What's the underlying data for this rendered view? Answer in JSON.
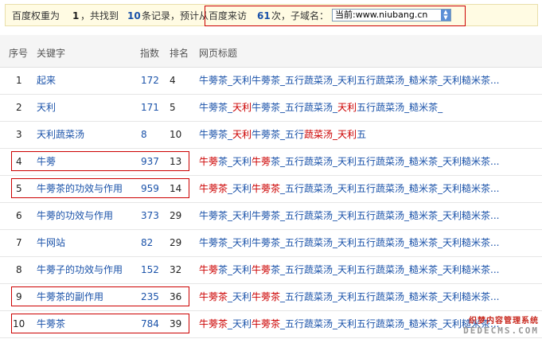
{
  "summary": {
    "prefix": "百度权重为",
    "weight": "1",
    "mid1": "，共找到",
    "count": "10",
    "mid2": "条记录，预计从百度来访",
    "visits": "61",
    "mid3": "次，子域名：",
    "subdomain_selected": "当前:www.niubang.cn"
  },
  "table": {
    "headers": {
      "seq": "序号",
      "keyword": "关键字",
      "index": "指数",
      "rank": "排名",
      "title": "网页标题"
    },
    "rows": [
      {
        "seq": "1",
        "keyword": "起来",
        "index": "172",
        "rank": "4",
        "title": [
          [
            "牛蒡茶_天利牛蒡茶_五行蔬菜汤_天利五行蔬菜汤_糙米茶_天利糙米茶...",
            false
          ]
        ]
      },
      {
        "seq": "2",
        "keyword": "天利",
        "index": "171",
        "rank": "5",
        "title": [
          [
            "牛蒡茶_",
            false
          ],
          [
            "天利",
            true
          ],
          [
            "牛蒡茶_五行蔬菜汤_",
            false
          ],
          [
            "天利",
            true
          ],
          [
            "五行蔬菜汤_糙米茶_",
            false
          ]
        ]
      },
      {
        "seq": "3",
        "keyword": "天利蔬菜汤",
        "index": "8",
        "rank": "10",
        "title": [
          [
            "牛蒡茶_",
            false
          ],
          [
            "天利",
            true
          ],
          [
            "牛蒡茶_五行",
            false
          ],
          [
            "蔬菜汤_天利",
            true
          ],
          [
            "五",
            false
          ]
        ]
      },
      {
        "seq": "4",
        "keyword": "牛蒡",
        "index": "937",
        "rank": "13",
        "title": [
          [
            "牛蒡",
            true
          ],
          [
            "茶_天利",
            false
          ],
          [
            "牛蒡",
            true
          ],
          [
            "茶_五行蔬菜汤_天利五行蔬菜汤_糙米茶_天利糙米茶...",
            false
          ]
        ]
      },
      {
        "seq": "5",
        "keyword": "牛蒡茶的功效与作用",
        "index": "959",
        "rank": "14",
        "title": [
          [
            "牛蒡茶",
            true
          ],
          [
            "_天利",
            false
          ],
          [
            "牛蒡茶",
            true
          ],
          [
            "_五行蔬菜汤_天利五行蔬菜汤_糙米茶_天利糙米茶...",
            false
          ]
        ]
      },
      {
        "seq": "6",
        "keyword": "牛蒡的功效与作用",
        "index": "373",
        "rank": "29",
        "title": [
          [
            "牛蒡茶_天利牛蒡茶_五行蔬菜汤_天利五行蔬菜汤_糙米茶_天利糙米茶...",
            false
          ]
        ]
      },
      {
        "seq": "7",
        "keyword": "牛网站",
        "index": "82",
        "rank": "29",
        "title": [
          [
            "牛蒡茶_天利牛蒡茶_五行蔬菜汤_天利五行蔬菜汤_糙米茶_天利糙米茶...",
            false
          ]
        ]
      },
      {
        "seq": "8",
        "keyword": "牛蒡子的功效与作用",
        "index": "152",
        "rank": "32",
        "title": [
          [
            "牛蒡",
            true
          ],
          [
            "茶_天利",
            false
          ],
          [
            "牛蒡",
            true
          ],
          [
            "茶_五行蔬菜汤_天利五行蔬菜汤_糙米茶_天利糙米茶...",
            false
          ]
        ]
      },
      {
        "seq": "9",
        "keyword": "牛蒡茶的副作用",
        "index": "235",
        "rank": "36",
        "title": [
          [
            "牛蒡茶",
            true
          ],
          [
            "_天利",
            false
          ],
          [
            "牛蒡茶",
            true
          ],
          [
            "_五行蔬菜汤_天利五行蔬菜汤_糙米茶_天利糙米茶...",
            false
          ]
        ]
      },
      {
        "seq": "10",
        "keyword": "牛蒡茶",
        "index": "784",
        "rank": "39",
        "title": [
          [
            "牛蒡茶",
            true
          ],
          [
            "_天利",
            false
          ],
          [
            "牛蒡茶",
            true
          ],
          [
            "_五行蔬菜汤_天利五行蔬菜汤_糙米茶_天利糙米茶...",
            false
          ]
        ]
      }
    ]
  },
  "highlighted_rows": [
    "4",
    "5",
    "9",
    "10"
  ],
  "watermark": {
    "line1": "织梦内容管理系统",
    "line2": "DEDECMS.COM"
  },
  "colors": {
    "link": "#1a52a9",
    "highlight": "#cc0000"
  }
}
